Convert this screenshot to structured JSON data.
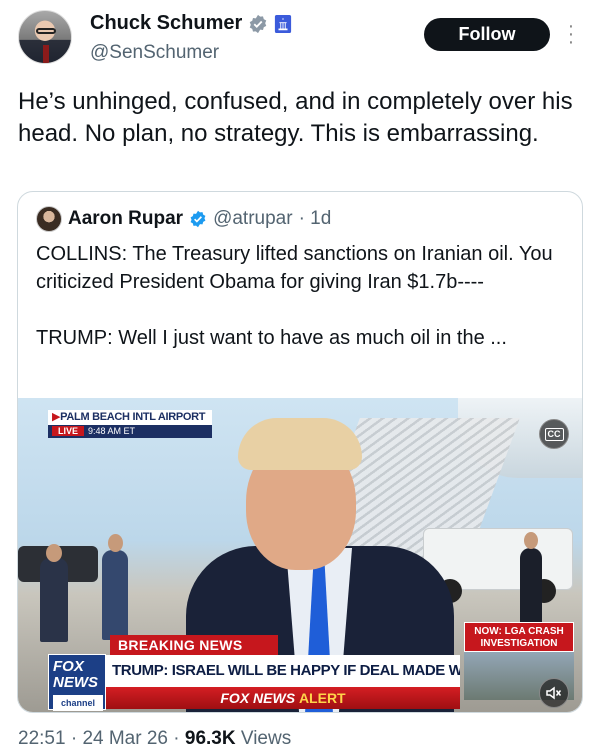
{
  "author": {
    "name": "Chuck Schumer",
    "handle": "@SenSchumer",
    "follow_label": "Follow"
  },
  "tweet": {
    "text": "He’s unhinged, confused, and in completely over his head. No plan, no strategy. This is embarrassing."
  },
  "quote": {
    "name": "Aaron Rupar",
    "handle": "@atrupar",
    "time": "· 1d",
    "text": "COLLINS: The Treasury lifted sanctions on Iranian oil. You criticized President Obama for giving Iran $1.7b----\n\nTRUMP: Well I just want to have as much oil in the ..."
  },
  "video": {
    "location": "PALM BEACH INTL AIRPORT",
    "live": "LIVE",
    "time": "9:48 AM ET",
    "cc": "CC",
    "now_label": "NOW: LGA CRASH INVESTIGATION",
    "breaking": "BREAKING NEWS",
    "fox_logo_top": "FOX",
    "fox_logo_mid": "NEWS",
    "fox_logo_ch": "channel",
    "headline": "TRUMP: ISRAEL WILL BE HAPPY IF DEAL MADE W/ IRAN",
    "alert_left": "FOX NEWS",
    "alert_right": "ALERT"
  },
  "meta": {
    "time": "22:51",
    "date": "24 Mar 26",
    "views_count": "96.3K",
    "views_label": "Views"
  },
  "colors": {
    "verified": "#1d9bf0",
    "fox_red": "#c6171d",
    "fox_blue": "#1c2f63"
  },
  "icons": [
    "verified-badge-icon",
    "government-icon",
    "more-options-icon",
    "closed-captions-icon",
    "mute-icon"
  ]
}
